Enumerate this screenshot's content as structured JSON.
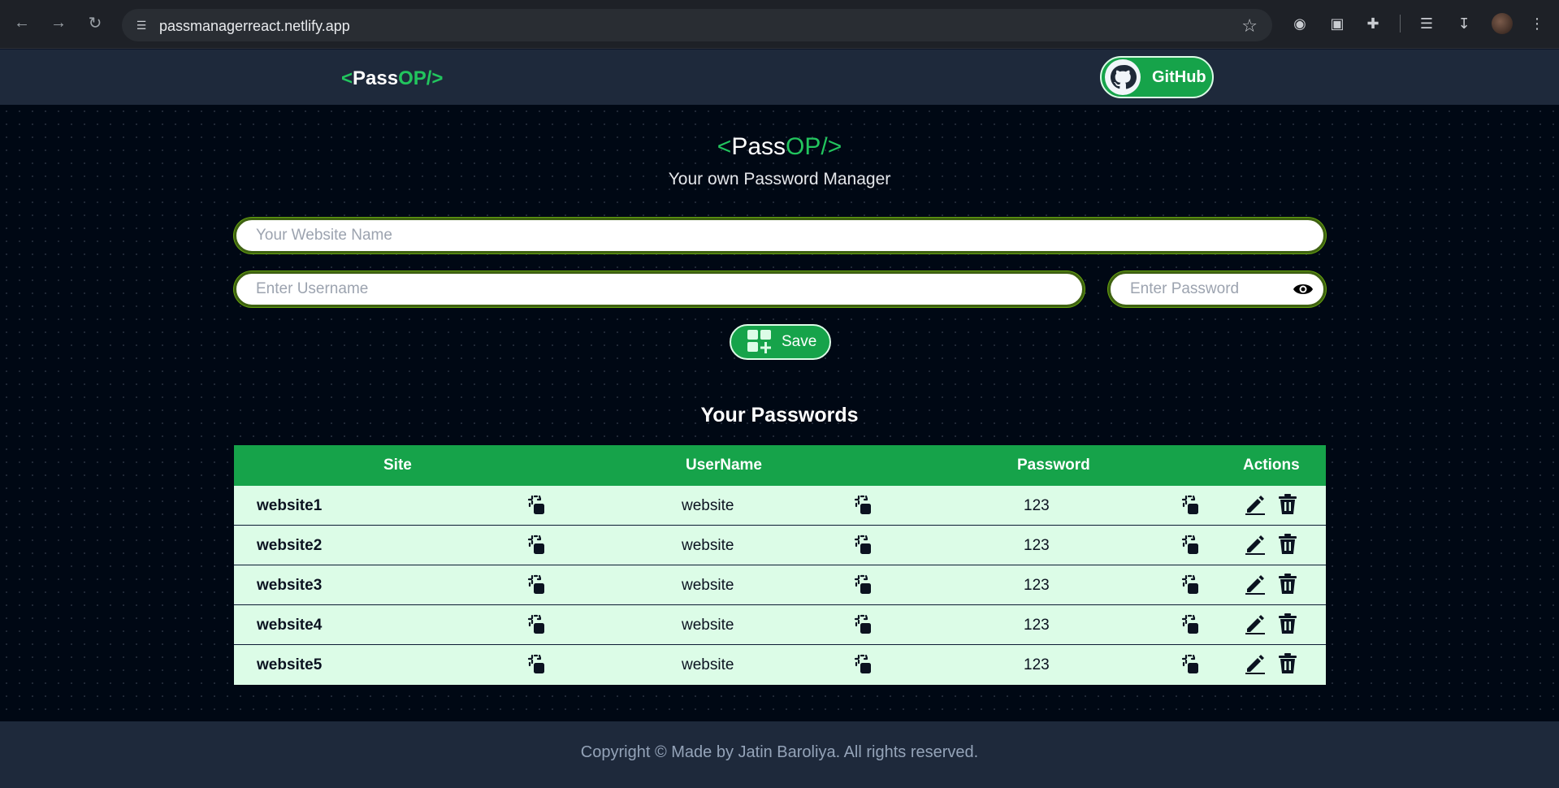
{
  "browser": {
    "url": "passmanagerreact.netlify.app"
  },
  "navbar": {
    "logo": {
      "open": "<",
      "pass": "Pass",
      "op": "OP/>"
    },
    "github_label": "GitHub"
  },
  "main": {
    "title": {
      "open": "<",
      "pass": "Pass",
      "op": "OP/>"
    },
    "subtitle": "Your own Password Manager",
    "website_placeholder": "Your Website Name",
    "username_placeholder": "Enter Username",
    "password_placeholder": "Enter Password",
    "save_label": "Save",
    "section_title": "Your Passwords"
  },
  "table": {
    "headers": {
      "site": "Site",
      "username": "UserName",
      "password": "Password",
      "actions": "Actions"
    },
    "rows": [
      {
        "site": "website1",
        "username": "website",
        "password": "123"
      },
      {
        "site": "website2",
        "username": "website",
        "password": "123"
      },
      {
        "site": "website3",
        "username": "website",
        "password": "123"
      },
      {
        "site": "website4",
        "username": "website",
        "password": "123"
      },
      {
        "site": "website5",
        "username": "website",
        "password": "123"
      }
    ]
  },
  "footer": {
    "text": "Copyright © Made by Jatin Baroliya. All rights reserved."
  },
  "colors": {
    "accent": "#22c55e",
    "button": "#16a34a",
    "row_bg": "#dcfce7",
    "page_bg": "#000814"
  }
}
